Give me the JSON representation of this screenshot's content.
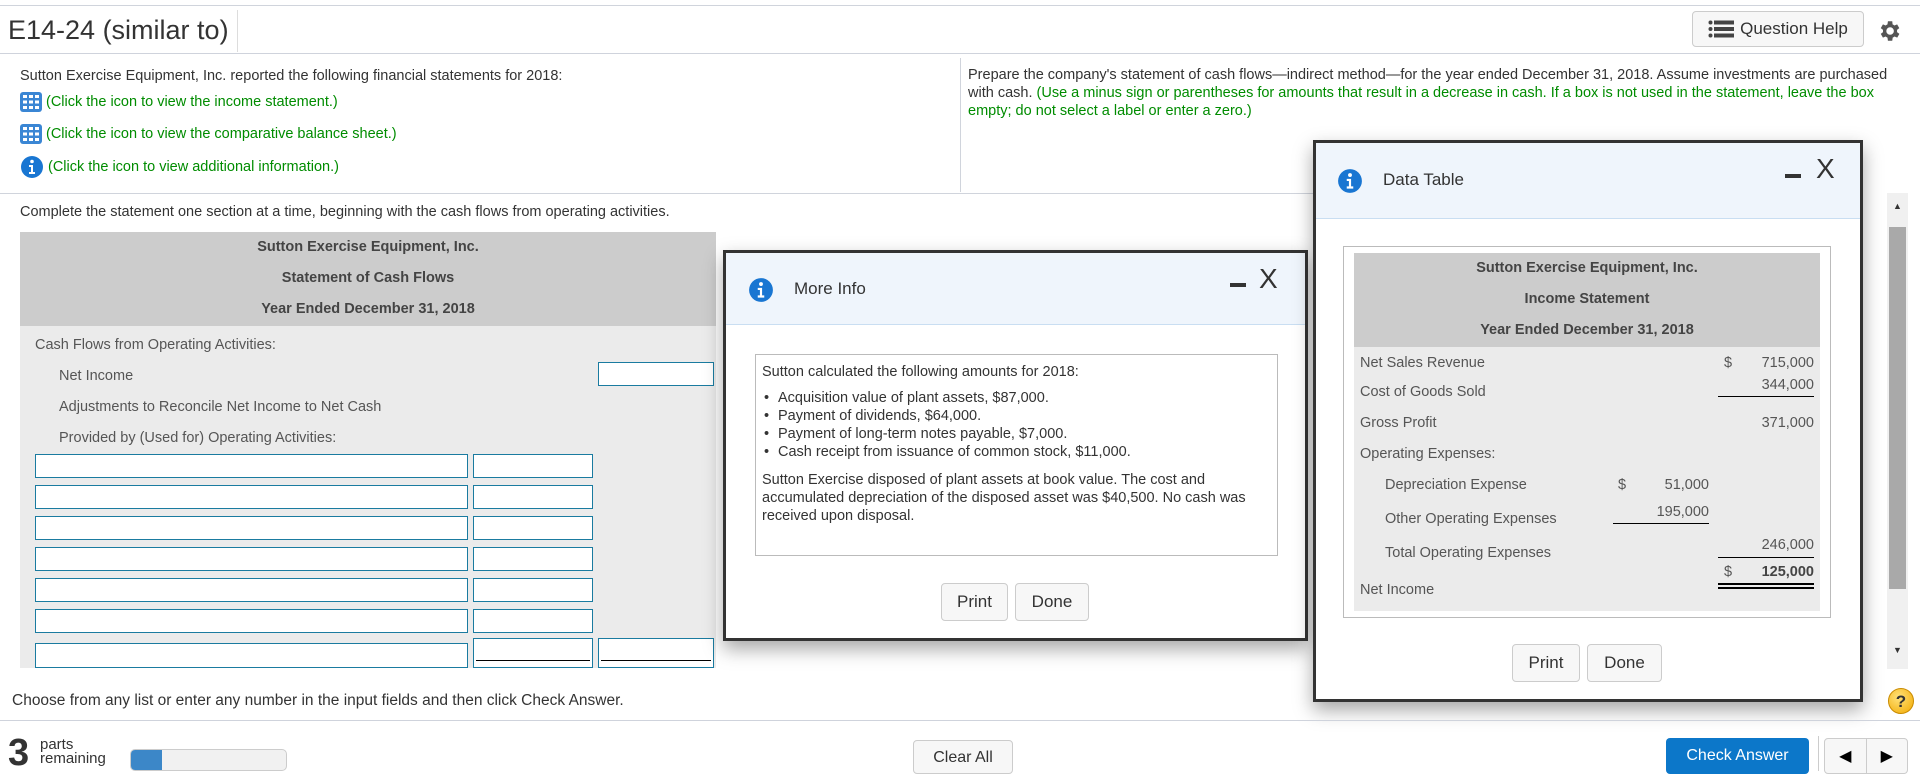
{
  "header": {
    "title": "E14-24 (similar to)",
    "question_help_label": "Question Help"
  },
  "intro": {
    "text": "Sutton Exercise Equipment, Inc. reported the following financial statements for 2018:",
    "links": [
      {
        "icon": "grid-table-icon",
        "label": "(Click the icon to view the income statement.)"
      },
      {
        "icon": "grid-table-icon",
        "label": "(Click the icon to view the comparative balance sheet.)"
      },
      {
        "icon": "info-icon",
        "label": "(Click the icon to view additional information.)"
      }
    ],
    "prompt": "Prepare the company's statement of cash flows—indirect method—for the year ended December 31, 2018. Assume investments are purchased with cash.",
    "prompt_note": "(Use a minus sign or parentheses for amounts that result in a decrease in cash. If a box is not used in the statement, leave the box empty; do not select a label or enter a zero.)"
  },
  "instruction": "Complete the statement one section at a time, beginning with the cash flows from operating activities.",
  "statement": {
    "company": "Sutton Exercise Equipment, Inc.",
    "title": "Statement of Cash Flows",
    "period": "Year Ended December 31, 2018",
    "section": "Cash Flows from Operating Activities:",
    "net_income_label": "Net Income",
    "adjust_label_1": "Adjustments to Reconcile Net Income to Net Cash",
    "adjust_label_2": "Provided by (Used for) Operating Activities:",
    "net_income_value": "",
    "adjustment_rows": [
      {
        "label": "",
        "amount": ""
      },
      {
        "label": "",
        "amount": ""
      },
      {
        "label": "",
        "amount": ""
      },
      {
        "label": "",
        "amount": ""
      },
      {
        "label": "",
        "amount": ""
      },
      {
        "label": "",
        "amount": ""
      },
      {
        "label": "",
        "amount": "",
        "total": ""
      }
    ]
  },
  "more_info": {
    "title": "More Info",
    "intro": "Sutton calculated the following amounts for 2018:",
    "items": [
      "Acquisition value of plant assets, $87,000.",
      "Payment of dividends, $64,000.",
      "Payment of long-term notes payable, $7,000.",
      "Cash receipt from issuance of common stock, $11,000."
    ],
    "note": "Sutton Exercise disposed of plant assets at book value. The cost and accumulated depreciation of the disposed asset was $40,500. No cash was received upon disposal.",
    "print_label": "Print",
    "done_label": "Done"
  },
  "data_table": {
    "title": "Data Table",
    "company": "Sutton Exercise Equipment, Inc.",
    "statement": "Income Statement",
    "period": "Year Ended December 31, 2018",
    "rows": {
      "net_sales": {
        "label": "Net Sales Revenue",
        "currency": "$",
        "value": "715,000"
      },
      "cogs": {
        "label": "Cost of Goods Sold",
        "value": "344,000"
      },
      "gross_profit": {
        "label": "Gross Profit",
        "value": "371,000"
      },
      "opex_header": {
        "label": "Operating Expenses:"
      },
      "depreciation": {
        "label": "Depreciation Expense",
        "currency": "$",
        "value": "51,000"
      },
      "other_opex": {
        "label": "Other Operating Expenses",
        "value": "195,000"
      },
      "total_opex": {
        "label": "Total Operating Expenses",
        "value": "246,000"
      },
      "net_income": {
        "label": "Net Income",
        "currency": "$",
        "value": "125,000"
      }
    },
    "print_label": "Print",
    "done_label": "Done"
  },
  "footer": {
    "note": "Choose from any list or enter any number in the input fields and then click Check Answer.",
    "parts_remaining": "3",
    "parts_label_1": "parts",
    "parts_label_2": "remaining",
    "progress_fraction": 0.2,
    "clear_all_label": "Clear All",
    "check_answer_label": "Check Answer",
    "prev_glyph": "◀",
    "next_glyph": "▶",
    "help_glyph": "?"
  },
  "colors": {
    "accent_blue": "#0c77c9",
    "link_green": "#008c00",
    "input_border": "#1a7ba0"
  }
}
